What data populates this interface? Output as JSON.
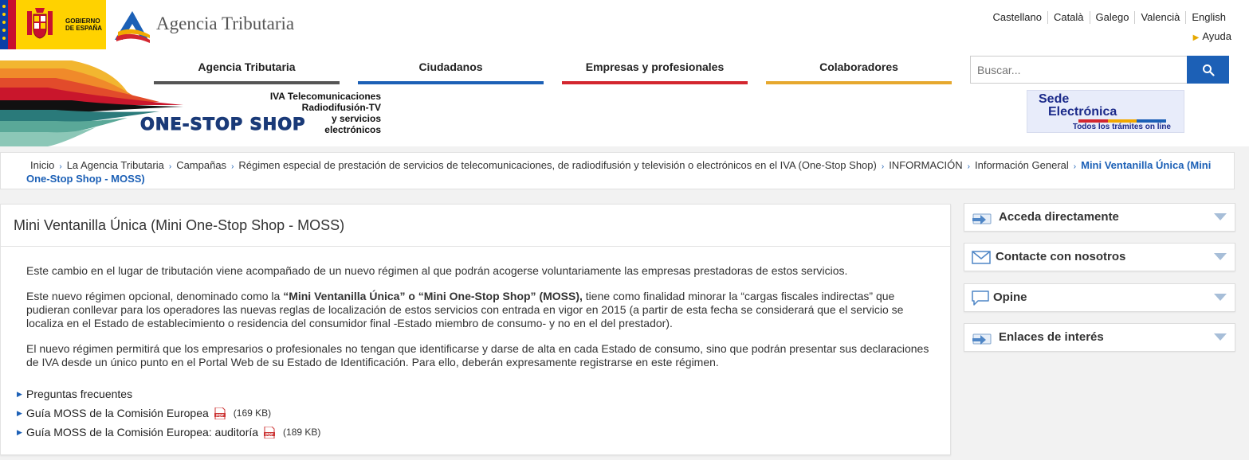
{
  "header": {
    "gov_logo_text": [
      "GOBIERNO",
      "DE ESPAÑA"
    ],
    "agency_name": "Agencia Tributaria",
    "languages": [
      "Castellano",
      "Català",
      "Galego",
      "Valencià",
      "English"
    ],
    "help_label": "Ayuda",
    "banner": {
      "title": "ONE-STOP SHOP",
      "subtitle_lines": [
        "IVA Telecomunicaciones",
        "Radiodifusión-TV",
        "y servicios",
        "electrónicos"
      ]
    },
    "nav": [
      {
        "label": "Agencia Tributaria",
        "color": "#555555"
      },
      {
        "label": "Ciudadanos",
        "color": "#1c60b6"
      },
      {
        "label": "Empresas y profesionales",
        "color": "#d3262f"
      },
      {
        "label": "Colaboradores",
        "color": "#e6a82e"
      }
    ],
    "search": {
      "placeholder": "Buscar...",
      "icon": "search-icon"
    },
    "sede": {
      "line1": "Sede",
      "line2": "Electrónica",
      "line3": "Todos los trámites on line"
    }
  },
  "breadcrumb": [
    "Inicio",
    "La Agencia Tributaria",
    "Campañas",
    "Régimen especial de prestación de servicios de telecomunicaciones, de radiodifusión y televisión o electrónicos en el IVA (One-Stop Shop)",
    "INFORMACIÓN",
    "Información General",
    "Mini Ventanilla Única (Mini One-Stop Shop - MOSS)"
  ],
  "main": {
    "title": "Mini Ventanilla Única (Mini One-Stop Shop - MOSS)",
    "p1": "Este cambio en el lugar de tributación viene acompañado de un nuevo régimen al que podrán acogerse voluntariamente las empresas prestadoras de estos servicios.",
    "p2_pre": "Este nuevo régimen opcional, denominado como la ",
    "p2_bold": "“Mini Ventanilla Única” o “Mini One-Stop Shop” (MOSS),",
    "p2_post": " tiene como finalidad minorar la “cargas fiscales indirectas” que pudieran conllevar para los operadores  las nuevas reglas de localización de estos servicios con entrada en vigor en 2015 (a partir de esta fecha se considerará que el servicio se localiza en el Estado de establecimiento o residencia del consumidor final -Estado miembro de consumo- y no en el del prestador).",
    "p3": "El nuevo régimen permitirá que los empresarios o profesionales no tengan que identificarse y darse de alta en cada Estado de consumo, sino que podrán presentar sus declaraciones de IVA desde un único punto en el Portal Web de su Estado de Identificación. Para ello, deberán expresamente registrarse en este régimen.",
    "links": [
      {
        "label": "Preguntas frecuentes",
        "size": ""
      },
      {
        "label": "Guía MOSS de la Comisión Europea",
        "size": "(169 KB)"
      },
      {
        "label": "Guía MOSS de la Comisión Europea: auditoría",
        "size": "(189 KB)"
      }
    ]
  },
  "sidebar": [
    {
      "label": "Acceda directamente",
      "icon": "direct-access-icon"
    },
    {
      "label": "Contacte con nosotros",
      "icon": "envelope-icon"
    },
    {
      "label": "Opine",
      "icon": "speech-bubble-icon"
    },
    {
      "label": "Enlaces de interés",
      "icon": "links-icon"
    }
  ]
}
